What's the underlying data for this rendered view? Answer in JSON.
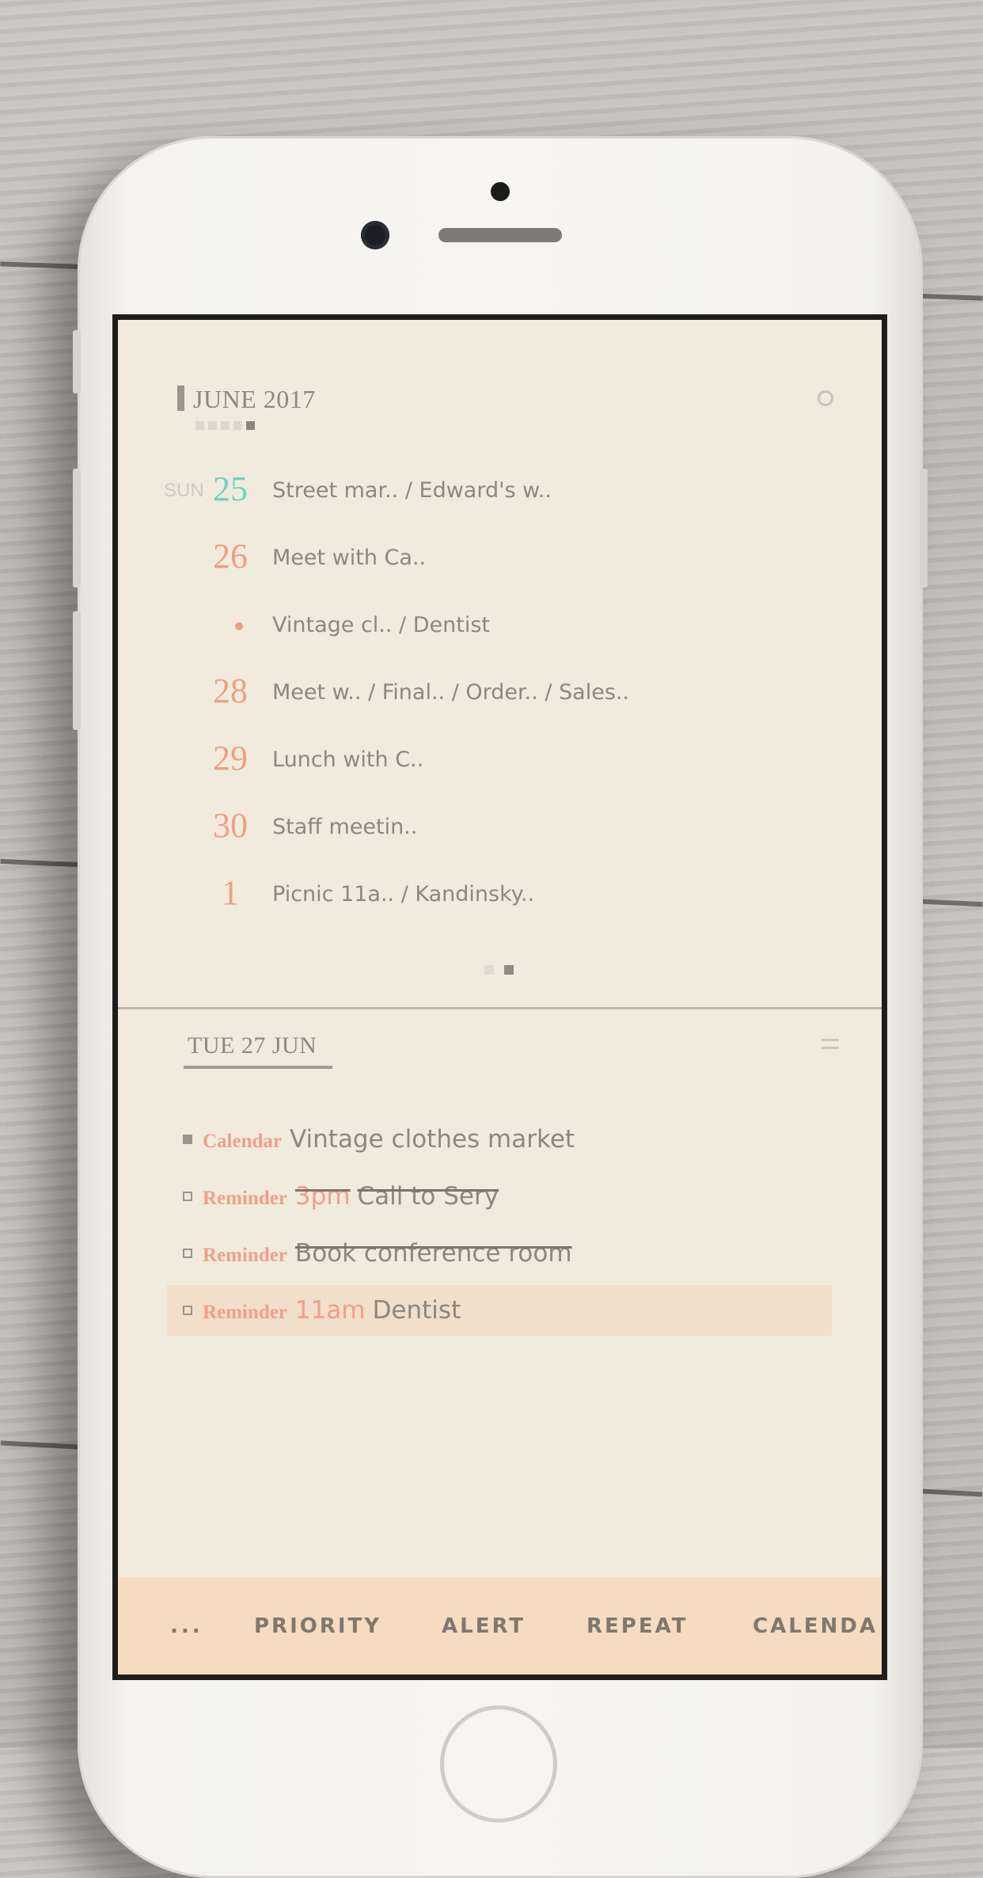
{
  "calendar": {
    "month_title": "JUNE 2017",
    "days": [
      {
        "weekday": "SUN",
        "day": "25",
        "today": true,
        "events": "Street mar.. / Edward's w.."
      },
      {
        "weekday": "",
        "day": "26",
        "events": "Meet with Ca.."
      },
      {
        "weekday": "",
        "day": "",
        "dot": true,
        "events": "Vintage cl.. / Dentist"
      },
      {
        "weekday": "",
        "day": "28",
        "events": "Meet w.. / Final.. / Order.. / Sales.."
      },
      {
        "weekday": "",
        "day": "29",
        "events": "Lunch with C.."
      },
      {
        "weekday": "",
        "day": "30",
        "events": "Staff meetin.."
      },
      {
        "weekday": "",
        "day": "1",
        "events": "Picnic 11a.. / Kandinsky.."
      }
    ]
  },
  "detail": {
    "selected_date": "TUE 27 JUN",
    "items": [
      {
        "type": "Calendar",
        "time": "",
        "title": "Vintage clothes market",
        "done": false,
        "bullet": "filled"
      },
      {
        "type": "Reminder",
        "time": "3pm",
        "title": "Call to Sery",
        "done": true,
        "bullet": "empty"
      },
      {
        "type": "Reminder",
        "time": "",
        "title": "Book conference room",
        "done": true,
        "bullet": "empty"
      },
      {
        "type": "Reminder",
        "time": "11am",
        "title": "Dentist",
        "done": false,
        "bullet": "empty",
        "highlighted": true
      }
    ]
  },
  "toolbar": {
    "more": "...",
    "priority": "PRIORITY",
    "alert": "ALERT",
    "repeat": "REPEAT",
    "calendar": "CALENDA"
  },
  "colors": {
    "accent_today": "#6fd3c0",
    "accent_date": "#ee9f85",
    "app_background": "#f1ebdd",
    "toolbar_background": "#f5dbc0"
  },
  "icons": {
    "settings": "settings-icon",
    "menu": "menu-icon"
  }
}
